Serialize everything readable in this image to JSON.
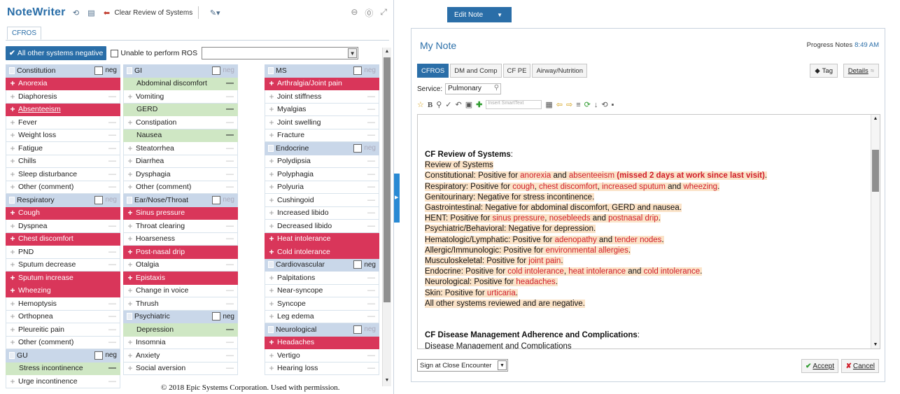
{
  "notewriter": {
    "title": "NoteWriter",
    "clear_label": "Clear Review of Systems",
    "tab": "CFROS",
    "all_neg_label": "All other systems negative",
    "unable_label": "Unable to perform ROS"
  },
  "neg_label": "neg",
  "columns": [
    {
      "sections": [
        {
          "title": "Constitution",
          "neg_dim": false,
          "items": [
            {
              "label": "Anorexia",
              "state": "pos"
            },
            {
              "label": "Diaphoresis",
              "state": "none"
            },
            {
              "label": "Absenteeism",
              "state": "pos",
              "underline": true
            },
            {
              "label": "Fever",
              "state": "none"
            },
            {
              "label": "Weight loss",
              "state": "none"
            },
            {
              "label": "Fatigue",
              "state": "none"
            },
            {
              "label": "Chills",
              "state": "none"
            },
            {
              "label": "Sleep disturbance",
              "state": "none"
            },
            {
              "label": "Other (comment)",
              "state": "none"
            }
          ]
        },
        {
          "title": "Respiratory",
          "neg_dim": true,
          "items": [
            {
              "label": "Cough",
              "state": "pos"
            },
            {
              "label": "Dyspnea",
              "state": "none"
            },
            {
              "label": "Chest discomfort",
              "state": "pos"
            },
            {
              "label": "PND",
              "state": "none"
            },
            {
              "label": "Sputum decrease",
              "state": "none"
            },
            {
              "label": "Sputum increase",
              "state": "pos"
            },
            {
              "label": "Wheezing",
              "state": "pos"
            },
            {
              "label": "Hemoptysis",
              "state": "none"
            },
            {
              "label": "Orthopnea",
              "state": "none"
            },
            {
              "label": "Pleureitic pain",
              "state": "none"
            },
            {
              "label": "Other (comment)",
              "state": "none"
            }
          ]
        },
        {
          "title": "GU",
          "neg_dim": false,
          "items": [
            {
              "label": "Stress incontinence",
              "state": "neg"
            },
            {
              "label": "Urge incontinence",
              "state": "none"
            }
          ]
        }
      ]
    },
    {
      "sections": [
        {
          "title": "GI",
          "neg_dim": true,
          "items": [
            {
              "label": "Abdominal discomfort",
              "state": "neg"
            },
            {
              "label": "Vomiting",
              "state": "none"
            },
            {
              "label": "GERD",
              "state": "neg"
            },
            {
              "label": "Constipation",
              "state": "none"
            },
            {
              "label": "Nausea",
              "state": "neg"
            },
            {
              "label": "Steatorrhea",
              "state": "none"
            },
            {
              "label": "Diarrhea",
              "state": "none"
            },
            {
              "label": "Dysphagia",
              "state": "none"
            },
            {
              "label": "Other (comment)",
              "state": "none"
            }
          ]
        },
        {
          "title": "Ear/Nose/Throat",
          "neg_dim": true,
          "items": [
            {
              "label": "Sinus pressure",
              "state": "pos"
            },
            {
              "label": "Throat clearing",
              "state": "none"
            },
            {
              "label": "Hoarseness",
              "state": "none"
            },
            {
              "label": "Post-nasal drip",
              "state": "pos"
            },
            {
              "label": "Otalgia",
              "state": "none"
            },
            {
              "label": "Epistaxis",
              "state": "pos"
            },
            {
              "label": "Change in voice",
              "state": "none"
            },
            {
              "label": "Thrush",
              "state": "none"
            }
          ]
        },
        {
          "title": "Psychiatric",
          "neg_dim": false,
          "items": [
            {
              "label": "Depression",
              "state": "neg"
            },
            {
              "label": "Insomnia",
              "state": "none"
            },
            {
              "label": "Anxiety",
              "state": "none"
            },
            {
              "label": "Social aversion",
              "state": "none"
            }
          ]
        }
      ]
    },
    {
      "sections": [
        {
          "title": "MS",
          "neg_dim": true,
          "items": [
            {
              "label": "Arthralgia/Joint pain",
              "state": "pos"
            },
            {
              "label": "Joint stiffness",
              "state": "none"
            },
            {
              "label": "Myalgias",
              "state": "none"
            },
            {
              "label": "Joint swelling",
              "state": "none"
            },
            {
              "label": "Fracture",
              "state": "none"
            }
          ]
        },
        {
          "title": "Endocrine",
          "neg_dim": true,
          "items": [
            {
              "label": "Polydipsia",
              "state": "none"
            },
            {
              "label": "Polyphagia",
              "state": "none"
            },
            {
              "label": "Polyuria",
              "state": "none"
            },
            {
              "label": "Cushingoid",
              "state": "none"
            },
            {
              "label": "Increased libido",
              "state": "none"
            },
            {
              "label": "Decreased libido",
              "state": "none"
            },
            {
              "label": "Heat intolerance",
              "state": "pos"
            },
            {
              "label": "Cold intolerance",
              "state": "pos"
            }
          ]
        },
        {
          "title": "Cardiovascular",
          "neg_dim": false,
          "items": [
            {
              "label": "Palpitations",
              "state": "none"
            },
            {
              "label": "Near-syncope",
              "state": "none"
            },
            {
              "label": "Syncope",
              "state": "none"
            },
            {
              "label": "Leg edema",
              "state": "none"
            }
          ]
        },
        {
          "title": "Neurological",
          "neg_dim": true,
          "items": [
            {
              "label": "Headaches",
              "state": "pos"
            },
            {
              "label": "Vertigo",
              "state": "none"
            },
            {
              "label": "Hearing loss",
              "state": "none"
            }
          ]
        }
      ]
    }
  ],
  "note": {
    "edit_tab": "Edit Note",
    "title": "My Note",
    "meta_label": "Progress Notes",
    "meta_time": "8:49 AM",
    "tabs": [
      "CFROS",
      "DM and Comp",
      "CF PE",
      "Airway/Nutrition"
    ],
    "tag_label": "Tag",
    "details_label": "Details",
    "service_label": "Service:",
    "service_value": "Pulmonary",
    "smarttext_placeholder": "Insert SmartText",
    "sign_label": "Sign at Close Encounter",
    "accept_label": "Accept",
    "cancel_label": "Cancel"
  },
  "note_lines": [
    {
      "cls": "sec",
      "segs": [
        {
          "t": "CF Review of Systems"
        },
        {
          "t": ":",
          "plain": true
        }
      ]
    },
    {
      "segs": [
        {
          "t": "Review of Systems"
        }
      ]
    },
    {
      "segs": [
        {
          "t": "Constitutional: Positive for "
        },
        {
          "t": "anorexia",
          "c": "red"
        },
        {
          "t": " and "
        },
        {
          "t": "absenteeism",
          "c": "red"
        },
        {
          "t": " "
        },
        {
          "t": "(missed 2 days at work since last visit)",
          "c": "bred"
        },
        {
          "t": "."
        }
      ]
    },
    {
      "segs": [
        {
          "t": "Respiratory: Positive for "
        },
        {
          "t": "cough",
          "c": "red"
        },
        {
          "t": ", "
        },
        {
          "t": "chest discomfort",
          "c": "red"
        },
        {
          "t": ", "
        },
        {
          "t": "increased sputum",
          "c": "red"
        },
        {
          "t": " and "
        },
        {
          "t": "wheezing",
          "c": "red"
        },
        {
          "t": "."
        }
      ]
    },
    {
      "segs": [
        {
          "t": "Genitourinary: Negative for stress incontinence."
        }
      ]
    },
    {
      "segs": [
        {
          "t": "Gastrointestinal: Negative for abdominal discomfort, GERD and nausea."
        }
      ]
    },
    {
      "segs": [
        {
          "t": "HENT: Positive for "
        },
        {
          "t": "sinus pressure",
          "c": "red"
        },
        {
          "t": ", "
        },
        {
          "t": "nosebleeds",
          "c": "red"
        },
        {
          "t": " and "
        },
        {
          "t": "postnasal drip",
          "c": "red"
        },
        {
          "t": "."
        }
      ]
    },
    {
      "segs": [
        {
          "t": "Psychiatric/Behavioral: Negative for depression."
        }
      ]
    },
    {
      "segs": [
        {
          "t": "Hematologic/Lymphatic: Positive for "
        },
        {
          "t": "adenopathy",
          "c": "red"
        },
        {
          "t": " and "
        },
        {
          "t": "tender nodes",
          "c": "red"
        },
        {
          "t": "."
        }
      ]
    },
    {
      "segs": [
        {
          "t": "Allergic/Immunologic: Positive for "
        },
        {
          "t": "environmental allergies",
          "c": "red"
        },
        {
          "t": "."
        }
      ]
    },
    {
      "segs": [
        {
          "t": "Musculoskeletal: Positive for "
        },
        {
          "t": "joint pain",
          "c": "red"
        },
        {
          "t": "."
        }
      ]
    },
    {
      "segs": [
        {
          "t": "Endocrine: Positive for "
        },
        {
          "t": "cold intolerance",
          "c": "red"
        },
        {
          "t": ", "
        },
        {
          "t": "heat intolerance",
          "c": "red"
        },
        {
          "t": " and "
        },
        {
          "t": "cold intolerance",
          "c": "red"
        },
        {
          "t": "."
        }
      ]
    },
    {
      "segs": [
        {
          "t": "Neurological: Positive for "
        },
        {
          "t": "headaches",
          "c": "red"
        },
        {
          "t": "."
        }
      ]
    },
    {
      "segs": [
        {
          "t": "Skin: Positive for "
        },
        {
          "t": "urticaria",
          "c": "red"
        },
        {
          "t": "."
        }
      ]
    },
    {
      "segs": [
        {
          "t": "All other systems reviewed and are negative."
        }
      ]
    },
    {
      "blank": true
    },
    {
      "blank": true
    },
    {
      "cls": "sec",
      "segs": [
        {
          "t": "CF Disease Management Adherence and Complications"
        },
        {
          "t": ":",
          "plain": true
        }
      ],
      "nohl": true
    },
    {
      "segs": [
        {
          "t": "Disease Management and Complications"
        }
      ],
      "nohl": true
    }
  ],
  "copyright": "© 2018 Epic Systems Corporation. Used with permission."
}
